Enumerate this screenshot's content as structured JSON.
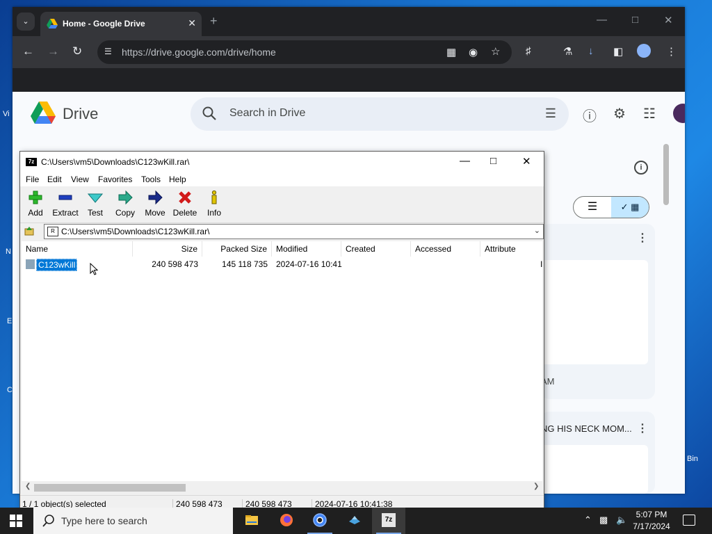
{
  "desktop": {
    "labels": [
      "Vi",
      "N",
      "E",
      "C",
      "Bin"
    ]
  },
  "chrome": {
    "tab_title": "Home - Google Drive",
    "url": "https://drive.google.com/drive/home",
    "new_tab_glyph": "+",
    "close_glyph": "✕"
  },
  "drive": {
    "app_name": "Drive",
    "search_placeholder": "Search in Drive",
    "card_text_1": "AM",
    "card_text_2": "NG HIS NECK MOM..."
  },
  "sevenzip": {
    "title": "C:\\Users\\vm5\\Downloads\\C123wKill.rar\\",
    "menu": [
      "File",
      "Edit",
      "View",
      "Favorites",
      "Tools",
      "Help"
    ],
    "toolbar": {
      "add": "Add",
      "extract": "Extract",
      "test": "Test",
      "copy": "Copy",
      "move": "Move",
      "delete": "Delete",
      "info": "Info"
    },
    "address": "C:\\Users\\vm5\\Downloads\\C123wKill.rar\\",
    "columns": {
      "name": "Name",
      "size": "Size",
      "packed": "Packed Size",
      "modified": "Modified",
      "created": "Created",
      "accessed": "Accessed",
      "attributes": "Attribute"
    },
    "rows": [
      {
        "name": "C123wKill",
        "size": "240 598 473",
        "packed": "145 118 735",
        "modified": "2024-07-16 10:41",
        "attr": "I"
      }
    ],
    "status": {
      "selected": "1 / 1 object(s) selected",
      "size": "240 598 473",
      "packed": "240 598 473",
      "date": "2024-07-16 10:41:38"
    }
  },
  "taskbar": {
    "search_placeholder": "Type here to search",
    "time": "5:07 PM",
    "date": "7/17/2024"
  }
}
